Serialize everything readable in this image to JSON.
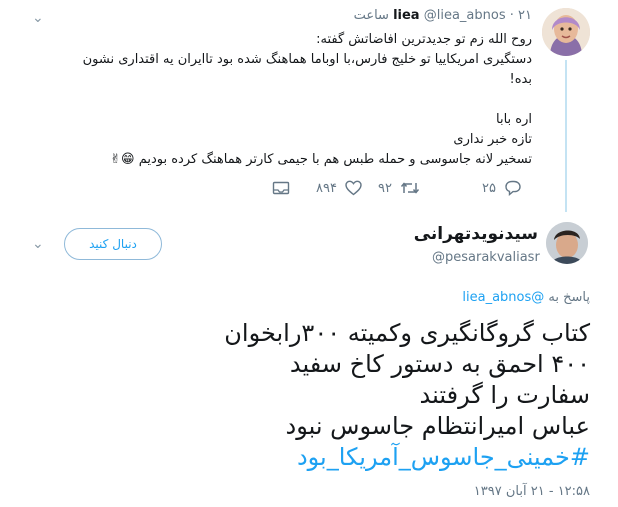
{
  "reply_tweet": {
    "display_name": "liea",
    "handle": "@liea_abnos",
    "separator": "·",
    "time": "۲۱ ساعت",
    "body_lines": [
      "روح الله زم تو جدیدترین افاضاتش گفته:",
      "دستگیری امریکاییا تو خلیج فارس،با اوباما هماهنگ شده بود تاایران یه اقتداری نشون",
      "بده!",
      "",
      "اره بابا",
      "تازه خبر نداری",
      "تسخیر لانه جاسوسی و حمله طبس هم با جیمی کارتر هماهنگ کرده بودیم"
    ],
    "emojis": "😁✌",
    "counts": {
      "replies": "۲۵",
      "retweets": "۹۲",
      "likes": "۸۹۴"
    }
  },
  "main_tweet": {
    "display_name": "سیدنویدتهرانی",
    "handle": "@pesarakvaliasr",
    "follow_label": "دنبال کنید",
    "replying_to_prefix": "پاسخ به",
    "replying_to_handle": "@liea_abnos",
    "text_lines": [
      "کتاب گروگانگیری وکمیته ۳۰۰رابخوان",
      "۴۰۰ احمق به دستور کاخ سفید",
      "سفارت را گرفتند",
      "عباس امیرانتظام جاسوس نبود"
    ],
    "hashtag": "#خمینی_جاسوس_آمریکا_بود",
    "timestamp": "۱۲:۵۸ - ۲۱ آبان ۱۳۹۷"
  },
  "colors": {
    "accent": "#1da1f2",
    "muted": "#657786",
    "thread": "#c4e3f3"
  }
}
